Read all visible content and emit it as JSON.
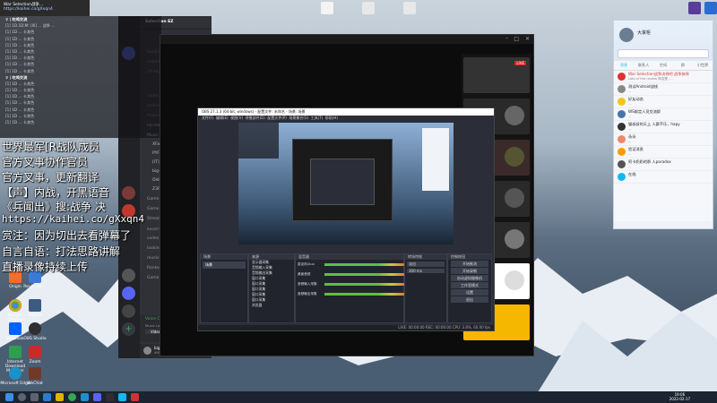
{
  "toast": {
    "line1": "War Selection战争...",
    "line2": "https://kaihei.co/gXxqn4"
  },
  "chat": {
    "header1": "♀ | 吃鸡交流",
    "header2": "♀ | 吃鸡交流",
    "lines1": [
      "[1] 1D.1D:M: [Ill] ... 战争 ...",
      "[1] 1D ... 卡其色",
      "[1] 1D ... 卡其色",
      "[1] 1D ... 卡其色",
      "[1] 1D ... 卡其色",
      "[1] 1D ... 卡其色",
      "[1] 1D ... 卡其色",
      "[1] 1D ... 卡其色"
    ],
    "lines2": [
      "[1] 1D ... 卡其色",
      "[1] 1D ... 卡其色",
      "[1] 1D ... 卡其色",
      "[1] 1D ... 卡其色",
      "[1] 1D ... 卡其色",
      "[1] 1D ... 卡其色",
      "[1] 1D ... 卡其色"
    ]
  },
  "overlay": [
    "世界最军[R战队成员",
    "官方叉事协作官员",
    "官方叉事，更新翻译",
    "【声】内战，开黑语音",
    "《兵闻出》搜:战争 决",
    "https://kaihei.co/gXxqn4",
    "赏注：因为切出去看弹幕了",
    "自言自语：打法思路讲解",
    "直播录像持续上传"
  ],
  "discord": {
    "server": "Selection EZ",
    "channels": [
      "foodies",
      "real-life gallery",
      "off-topic",
      "codes",
      "looking-for-squad",
      "music-commands",
      "no-mic",
      "Music Lobby"
    ],
    "users": [
      "XFactorLive",
      "PYF55",
      "[IT] Rhys",
      "big-bad-wolf",
      "OldPoker",
      "Z3FBKI"
    ],
    "channels2": [
      "Game Lobby",
      "Game Lobby",
      "Streaming Lobby"
    ],
    "section": "REGISTERED MEMBERS",
    "channels3": [
      "codes",
      "looking-for-squad",
      "music-commands",
      "Ranked Lobby",
      "Game Lobby"
    ],
    "voice_status": "Voice Connected",
    "voice_sub": "Music Lobby / Warfa...",
    "video_label": "Video",
    "screen_label": "Screen",
    "user_name": "big-bad-wolf",
    "user_tag": "#0048"
  },
  "obs": {
    "title": "OBS 27.1.3 (64-bit, windows) - 配置文件: 未命名 - 场景: 场景",
    "menu": [
      "文件(F)",
      "编辑(E)",
      "视图(V)",
      "停靠部件(D)",
      "配置文件(P)",
      "场景集合(S)",
      "工具(T)",
      "帮助(H)"
    ],
    "docks": [
      "场景",
      "来源",
      "混音器",
      "转场特效",
      "控制按钮"
    ],
    "scene_item": "场景",
    "sources": [
      "显示器采集",
      "音频输入采集",
      "音频输出采集",
      "窗口采集",
      "窗口采集",
      "窗口采集",
      "窗口采集",
      "窗口采集",
      "浏览器"
    ],
    "mixer": [
      "麦克风/Aux",
      "桌面音频",
      "音频输入采集",
      "音频输出采集"
    ],
    "transition": "淡出",
    "duration": "300 ms",
    "controls": [
      "开始推流",
      "开始录制",
      "启动虚拟摄像机",
      "工作室模式",
      "设置",
      "退出"
    ],
    "status": "LIVE: 00:00:00   REC: 00:00:00   CPU: 3.8%, 60.00 fps"
  },
  "qq": {
    "name": "大掌柜",
    "tabs": [
      "消息",
      "联系人",
      "空间",
      "群",
      "小世界"
    ],
    "items": [
      {
        "name": "War Selection战争决择吧 战争抉择",
        "msg": "Lots of the review 阵容是 ..."
      },
      {
        "name": "测试Android战线",
        "msg": "..."
      },
      {
        "name": "好友动态",
        "msg": "..."
      },
      {
        "name": "WS绑定人员交流群",
        "msg": "..."
      },
      {
        "name": "猫叔叔的天上 人赛不乐，hapy",
        "msg": "..."
      },
      {
        "name": "朵朵",
        "msg": "..."
      },
      {
        "name": "验证消息",
        "msg": "..."
      },
      {
        "name": "阿卡奶奶的那 人paradox",
        "msg": "..."
      },
      {
        "name": "在线",
        "msg": ""
      }
    ]
  },
  "desktop_icons": [
    "Origin",
    "Steam",
    "Kubera",
    "Origin GFM",
    "Revit LBI ...",
    "Google Chrome",
    "Dropbox",
    "OBS Studio",
    "Internet Download Manager",
    "Zoom",
    "Microsoft Edge",
    "WeChat"
  ],
  "clock": {
    "time": "19:06",
    "date": "2022-02-17"
  },
  "bigwin_status": {
    "live": "LIVE"
  },
  "colors": {
    "accent_discord": "#5865f2",
    "voice_green": "#3ba55d",
    "qq_blue": "#12b7f5",
    "obs_bg": "#2b2e38"
  }
}
